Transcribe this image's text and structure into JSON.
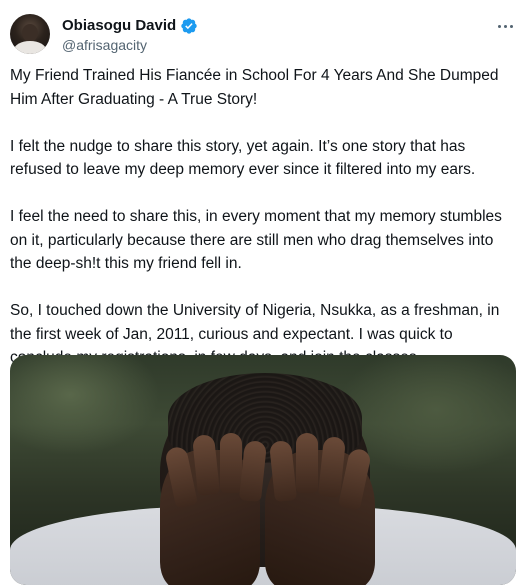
{
  "author": {
    "display_name": "Obiasogu David",
    "handle": "@afrisagacity",
    "verified": true,
    "verified_color": "#1d9bf0"
  },
  "menu": {
    "icon": "more-horizontal-icon"
  },
  "tweet": {
    "paragraphs": [
      "My Friend Trained His Fiancée in School For 4 Years And She Dumped Him After Graduating - A True Story!",
      "I felt the nudge to share this story, yet again. It’s one story that has refused to leave my deep memory ever since it filtered into my ears.",
      "I feel the need to share this, in every moment that my memory stumbles on it, particularly because there are still men who drag themselves into the deep-sh!t this my friend fell in.",
      "So, I touched down the University of Nigeria, Nsukka, as a freshman, in the first week of Jan, 2011, curious and expectant. I was quick to conclude my registrations, in few days, and join the classes."
    ]
  },
  "media": {
    "description_icon": "photo-man-covering-face"
  },
  "colors": {
    "text_primary": "#0f1419",
    "text_secondary": "#536471",
    "background": "#ffffff"
  }
}
